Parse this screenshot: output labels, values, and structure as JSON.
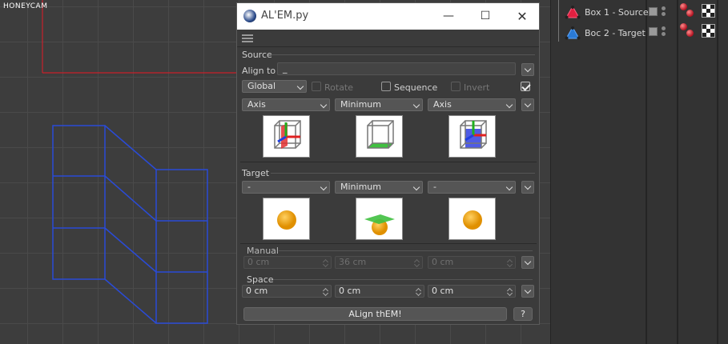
{
  "watermark": "HONEYCAM",
  "objects": [
    {
      "name": "Box 1 - Source",
      "icon": "cube-red-icon"
    },
    {
      "name": "Boc 2 - Target",
      "icon": "cube-blue-icon"
    }
  ],
  "dialog": {
    "title": "AL'EM.py",
    "source": {
      "section_label": "Source",
      "align_to_label": "Align to",
      "align_to_value": "_",
      "space_mode": "Global",
      "rotate_label": "Rotate",
      "sequence_label": "Sequence",
      "invert_label": "Invert",
      "mode_x": "Axis",
      "mode_y": "Minimum",
      "mode_z": "Axis"
    },
    "target": {
      "section_label": "Target",
      "mode_x": "-",
      "mode_y": "Minimum",
      "mode_z": "-"
    },
    "manual": {
      "section_label": "Manual",
      "x": "0 cm",
      "y": "36 cm",
      "z": "0 cm"
    },
    "space": {
      "section_label": "Space",
      "x": "0 cm",
      "y": "0 cm",
      "z": "0 cm"
    },
    "align_button": "ALign thEM!",
    "help_button": "?"
  },
  "colors": {
    "wireframe": "#2a4bd6",
    "guide": "#c8202a",
    "background": "#3d3d3d"
  }
}
